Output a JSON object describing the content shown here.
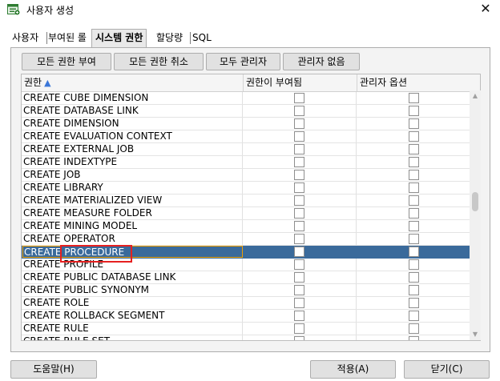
{
  "window": {
    "title": "사용자 생성"
  },
  "tabs": [
    {
      "label": "사용자",
      "active": false
    },
    {
      "label": "부여된 롤",
      "active": false
    },
    {
      "label": "시스템 권한",
      "active": true
    },
    {
      "label": "할당량",
      "active": false
    },
    {
      "label": "SQL",
      "active": false
    }
  ],
  "toolbar": {
    "grant_all": "모든 권한 부여",
    "revoke_all": "모든 권한 취소",
    "all_admin": "모두 관리자",
    "no_admin": "관리자 없음"
  },
  "grid": {
    "columns": [
      "권한",
      "권한이 부여됨",
      "관리자 옵션"
    ],
    "sorted_column": "권한",
    "sort_direction": "ascending",
    "rows": [
      {
        "privilege": "CREATE CUBE DIMENSION",
        "granted": false,
        "admin_option": false
      },
      {
        "privilege": "CREATE DATABASE LINK",
        "granted": false,
        "admin_option": false
      },
      {
        "privilege": "CREATE DIMENSION",
        "granted": false,
        "admin_option": false
      },
      {
        "privilege": "CREATE EVALUATION CONTEXT",
        "granted": false,
        "admin_option": false
      },
      {
        "privilege": "CREATE EXTERNAL JOB",
        "granted": false,
        "admin_option": false
      },
      {
        "privilege": "CREATE INDEXTYPE",
        "granted": false,
        "admin_option": false
      },
      {
        "privilege": "CREATE JOB",
        "granted": false,
        "admin_option": false
      },
      {
        "privilege": "CREATE LIBRARY",
        "granted": false,
        "admin_option": false
      },
      {
        "privilege": "CREATE MATERIALIZED VIEW",
        "granted": false,
        "admin_option": false
      },
      {
        "privilege": "CREATE MEASURE FOLDER",
        "granted": false,
        "admin_option": false
      },
      {
        "privilege": "CREATE MINING MODEL",
        "granted": false,
        "admin_option": false
      },
      {
        "privilege": "CREATE OPERATOR",
        "granted": false,
        "admin_option": false
      },
      {
        "privilege": "CREATE PROCEDURE",
        "granted": false,
        "admin_option": false,
        "selected": true
      },
      {
        "privilege": "CREATE PROFILE",
        "granted": false,
        "admin_option": false
      },
      {
        "privilege": "CREATE PUBLIC DATABASE LINK",
        "granted": false,
        "admin_option": false
      },
      {
        "privilege": "CREATE PUBLIC SYNONYM",
        "granted": false,
        "admin_option": false
      },
      {
        "privilege": "CREATE ROLE",
        "granted": false,
        "admin_option": false
      },
      {
        "privilege": "CREATE ROLLBACK SEGMENT",
        "granted": false,
        "admin_option": false
      },
      {
        "privilege": "CREATE RULE",
        "granted": false,
        "admin_option": false
      },
      {
        "privilege": "CREATE RULE SET",
        "granted": false,
        "admin_option": false
      }
    ]
  },
  "buttons": {
    "help": "도움말(H)",
    "apply": "적용(A)",
    "close": "닫기(C)"
  },
  "colors": {
    "selection": "#3a6a9b",
    "focus_border": "#f0a000",
    "highlight_box": "#e52020",
    "sort_arrow": "#3b77d8"
  },
  "icons": {
    "app": "create-user-icon",
    "close": "close-icon",
    "sort": "sort-ascending-icon"
  }
}
